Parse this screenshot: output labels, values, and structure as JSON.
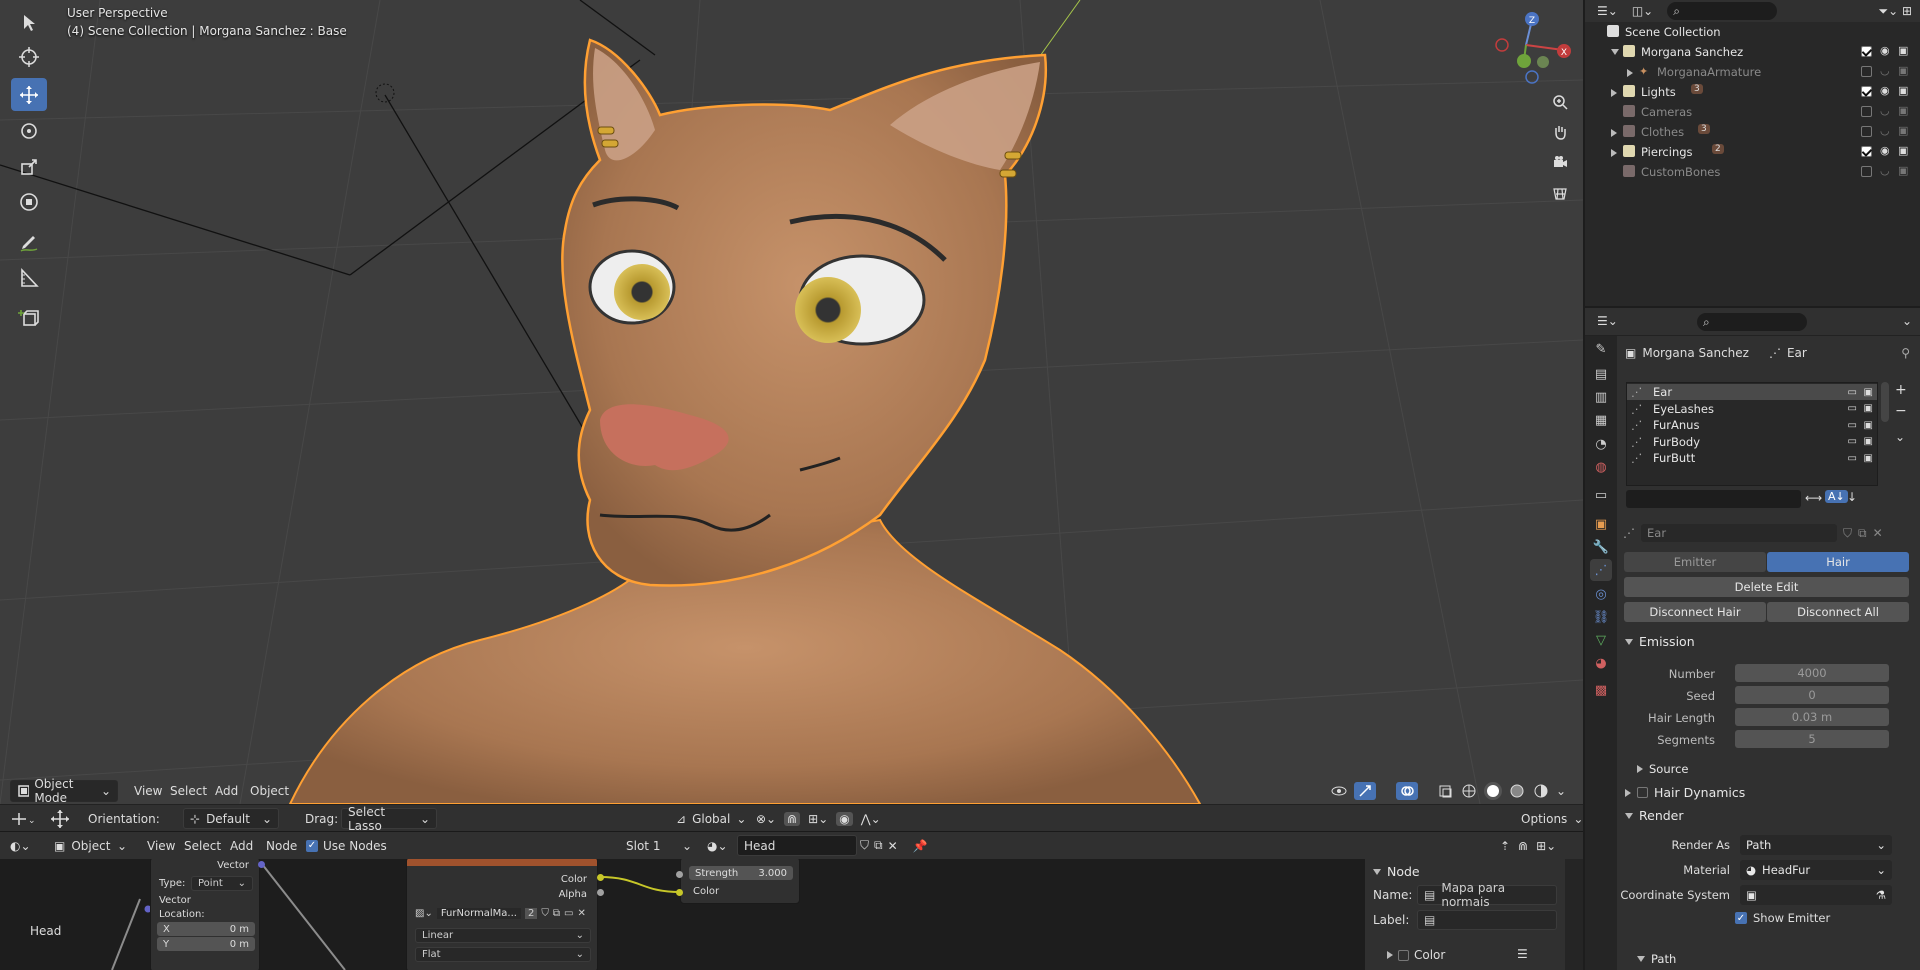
{
  "viewport": {
    "perspective_label": "User Perspective",
    "collection_label": "(4) Scene Collection | Morgana Sanchez : Base",
    "header": {
      "mode": "Object Mode",
      "menus": [
        "View",
        "Select",
        "Add",
        "Object"
      ]
    }
  },
  "tool_settings": {
    "orientation_label": "Orientation:",
    "orientation_value": "Default",
    "drag_label": "Drag:",
    "drag_value": "Select Lasso",
    "transform_orientation": "Global",
    "options_label": "Options"
  },
  "node_editor": {
    "header": {
      "type": "Object",
      "menus": [
        "View",
        "Select",
        "Add",
        "Node"
      ],
      "use_nodes_label": "Use Nodes",
      "slot": "Slot 1",
      "material": "Head"
    },
    "frame_label": "Head",
    "mapping_node": {
      "vector_out": "Vector",
      "type_label": "Type:",
      "type_value": "Point",
      "vector_in": "Vector",
      "location_label": "Location:",
      "x_label": "X",
      "x_value": "0 m",
      "y_label": "Y",
      "y_value": "0 m"
    },
    "image_node": {
      "title": "FurNormalMap.jpg",
      "color_out": "Color",
      "alpha_out": "Alpha",
      "image_name": "FurNormalMa...",
      "users": "2",
      "interpolation": "Linear",
      "projection": "Flat"
    },
    "normal_node": {
      "strength_label": "Strength",
      "strength_value": "3.000",
      "color_in": "Color"
    },
    "sidebar": {
      "section": "Node",
      "name_label": "Name:",
      "name_value": "Mapa para normais",
      "label_label": "Label:",
      "label_value": "",
      "color_label": "Color"
    }
  },
  "outliner": {
    "rows": [
      {
        "label": "Scene Collection",
        "dim": false
      },
      {
        "label": "Morgana Sanchez",
        "dim": false
      },
      {
        "label": "MorganaArmature",
        "dim": true
      },
      {
        "label": "Lights",
        "dim": false,
        "badge": "3"
      },
      {
        "label": "Cameras",
        "dim": true
      },
      {
        "label": "Clothes",
        "dim": true,
        "badge": "3"
      },
      {
        "label": "Piercings",
        "dim": false,
        "badge": "2"
      },
      {
        "label": "CustomBones",
        "dim": true
      }
    ]
  },
  "properties": {
    "breadcrumb_object": "Morgana Sanchez",
    "breadcrumb_item": "Ear",
    "particle_list": [
      "Ear",
      "EyeLashes",
      "FurAnus",
      "FurBody",
      "FurButt"
    ],
    "settings_name": "Ear",
    "type_tabs": [
      "Emitter",
      "Hair"
    ],
    "delete_edit": "Delete Edit",
    "disconnect_hair": "Disconnect Hair",
    "disconnect_all": "Disconnect All",
    "emission": {
      "title": "Emission",
      "number_label": "Number",
      "number_value": "4000",
      "seed_label": "Seed",
      "seed_value": "0",
      "hair_length_label": "Hair Length",
      "hair_length_value": "0.03 m",
      "segments_label": "Segments",
      "segments_value": "5",
      "source_label": "Source"
    },
    "hair_dynamics_label": "Hair Dynamics",
    "render": {
      "title": "Render",
      "render_as_label": "Render As",
      "render_as_value": "Path",
      "material_label": "Material",
      "material_value": "HeadFur",
      "coord_label": "Coordinate System",
      "show_emitter_label": "Show Emitter",
      "path_label": "Path"
    }
  },
  "colors": {
    "accent": "#4772b3",
    "selection_outline": "#ffa033",
    "skin": "#b88660"
  }
}
